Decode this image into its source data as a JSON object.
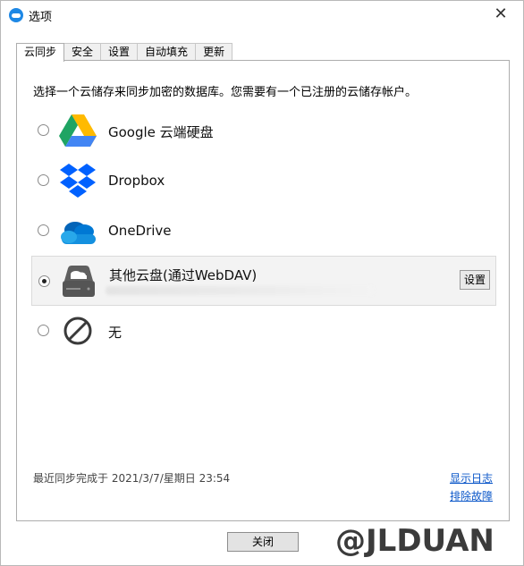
{
  "window": {
    "title": "选项",
    "close_glyph": "✕"
  },
  "tabs": [
    {
      "label": "云同步",
      "active": true
    },
    {
      "label": "安全",
      "active": false
    },
    {
      "label": "设置",
      "active": false
    },
    {
      "label": "自动填充",
      "active": false
    },
    {
      "label": "更新",
      "active": false
    }
  ],
  "panel": {
    "intro": "选择一个云储存来同步加密的数据库。您需要有一个已注册的云储存帐户。",
    "options": [
      {
        "label": "Google 云端硬盘",
        "icon": "google-drive-icon",
        "selected": false
      },
      {
        "label": "Dropbox",
        "icon": "dropbox-icon",
        "selected": false
      },
      {
        "label": "OneDrive",
        "icon": "onedrive-icon",
        "selected": false
      },
      {
        "label": "其他云盘(通过WebDAV)",
        "icon": "webdav-server-icon",
        "selected": true,
        "settings_label": "设置"
      },
      {
        "label": "无",
        "icon": "none-icon",
        "selected": false
      }
    ],
    "last_sync": "最近同步完成于 2021/3/7/星期日 23:54",
    "show_log_link": "显示日志",
    "troubleshoot_link": "排除故障"
  },
  "footer": {
    "close_label": "关闭"
  },
  "watermark": "@JLDUAN",
  "colors": {
    "link": "#0b57c9",
    "app_icon": "#1e88e5",
    "selected_row_bg": "#f3f3f3"
  }
}
